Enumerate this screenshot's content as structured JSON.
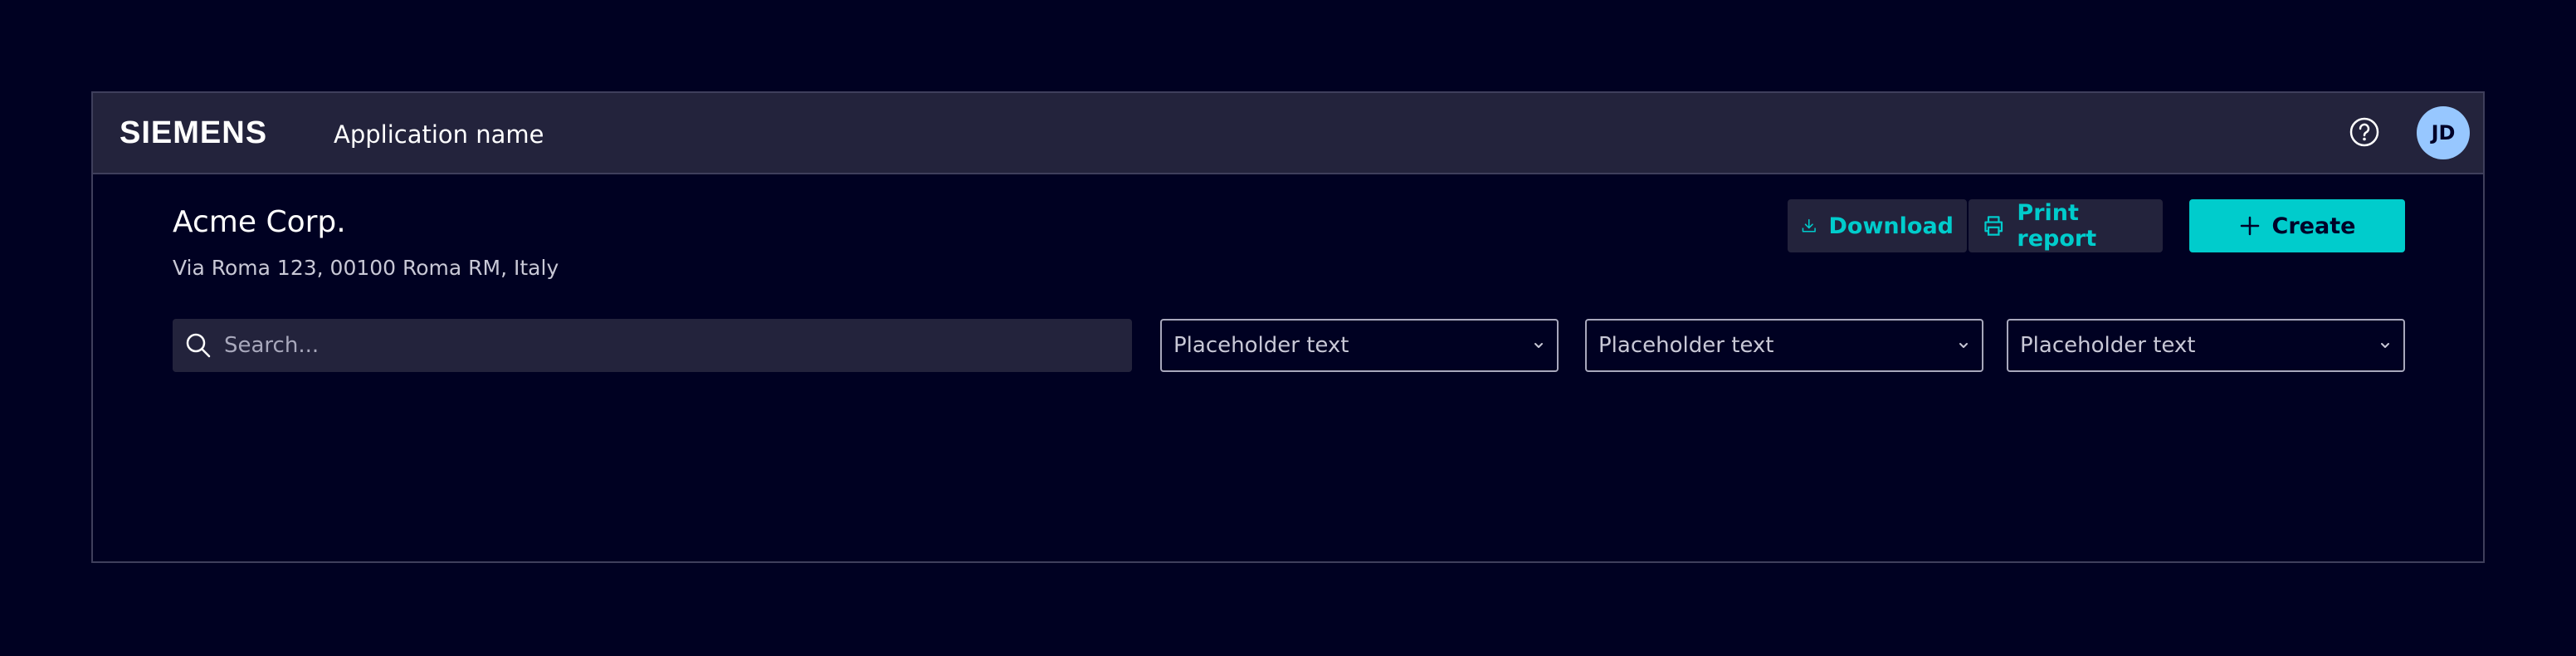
{
  "header": {
    "logo": "SIEMENS",
    "app_name": "Application name",
    "avatar_initials": "JD"
  },
  "page": {
    "company": "Acme Corp.",
    "address": "Via Roma 123, 00100 Roma RM, Italy"
  },
  "toolbar": {
    "download_label": "Download",
    "print_label": "Print report",
    "create_label": "Create"
  },
  "filters": {
    "search_placeholder": "Search...",
    "selects": [
      {
        "value": "Placeholder text"
      },
      {
        "value": "Placeholder text"
      },
      {
        "value": "Placeholder text"
      }
    ]
  },
  "colors": {
    "background": "#000122",
    "header": "#23233c",
    "accent": "#00cccc",
    "avatar": "#97c7ff"
  },
  "icons": [
    "help-icon",
    "download-icon",
    "print-icon",
    "plus-icon",
    "search-icon",
    "chevron-down-icon"
  ]
}
